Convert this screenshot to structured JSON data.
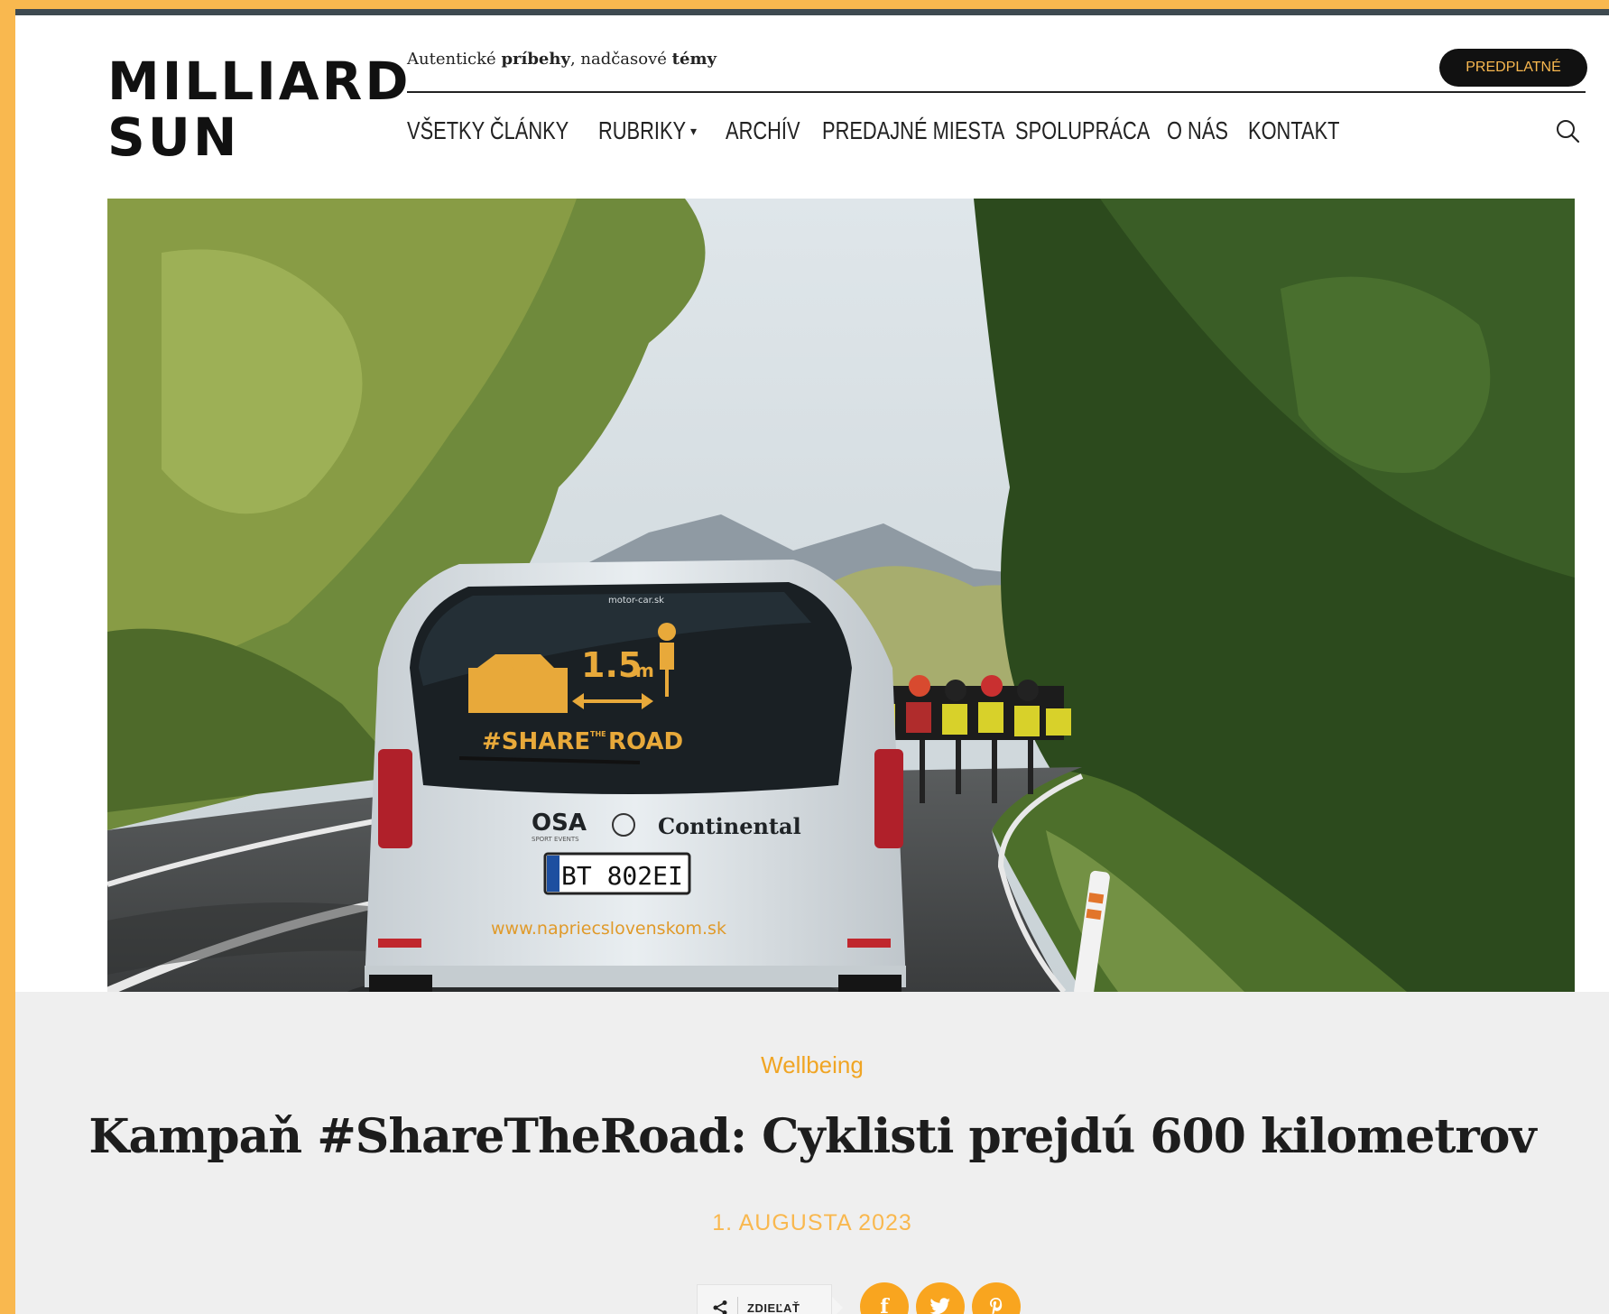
{
  "header": {
    "logo_line1": "MILLIARD",
    "logo_line2": "SUN",
    "tagline_part1": "Autentické ",
    "tagline_bold1": "príbehy",
    "tagline_part2": ", nadčasové ",
    "tagline_bold2": "témy",
    "subscribe_label": "PREDPLATNÉ"
  },
  "nav": {
    "items": [
      {
        "label": "VŠETKY ČLÁNKY"
      },
      {
        "label": "RUBRIKY"
      },
      {
        "label": "ARCHÍV"
      },
      {
        "label": "PREDAJNÉ MIESTA"
      },
      {
        "label": "SPOLUPRÁCA"
      },
      {
        "label": "O NÁS"
      },
      {
        "label": "KONTAKT"
      }
    ],
    "rubriky_caret": "▾",
    "search_icon": "search-icon"
  },
  "hero": {
    "van_sticker_distance": "1.5",
    "van_sticker_unit": "m",
    "van_sticker_tag": "#SHARE",
    "van_sticker_the": "THE",
    "van_sticker_road": "ROAD",
    "van_top_text": "motor-car.sk",
    "van_sponsor1": "OSA",
    "van_sponsor1_sub": "SPORT EVENTS",
    "van_sponsor2": "Continental",
    "van_plate": "BT 802EI",
    "van_website": "www.napriecslovenskom.sk"
  },
  "article": {
    "category": "Wellbeing",
    "title": "Kampaň #ShareTheRoad: Cyklisti prejdú 600 kilometrov",
    "date": "1. AUGUSTA 2023"
  },
  "share": {
    "label": "ZDIEĽAŤ",
    "facebook_glyph": "f",
    "twitter_glyph": "t",
    "pinterest_glyph": "p"
  },
  "colors": {
    "accent": "#f9b84f",
    "category": "#f0a524",
    "dark": "#111111",
    "top_border": "#3e4a50"
  }
}
